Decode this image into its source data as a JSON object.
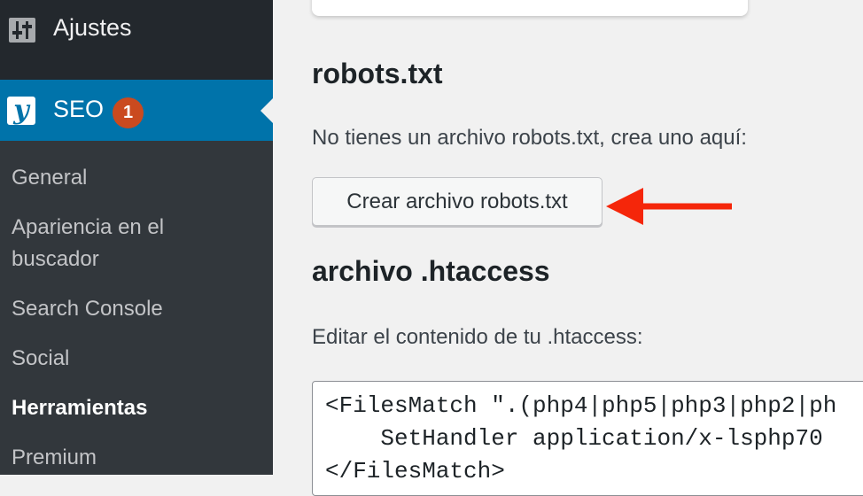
{
  "sidebar": {
    "ajustes": {
      "label": "Ajustes",
      "icon": "sliders-icon"
    },
    "seo": {
      "label": "SEO",
      "badge": "1",
      "logo_letter": "y",
      "icon": "yoast-logo-icon"
    },
    "items": [
      {
        "label": "General"
      },
      {
        "label": "Apariencia en el"
      },
      {
        "label": "buscador"
      },
      {
        "label": "Search Console"
      },
      {
        "label": "Social"
      },
      {
        "label": "Herramientas"
      },
      {
        "label": "Premium"
      }
    ]
  },
  "main": {
    "robots": {
      "heading": "robots.txt",
      "description": "No tienes un archivo robots.txt, crea uno aquí:",
      "button_label": "Crear archivo robots.txt"
    },
    "htaccess": {
      "heading": "archivo .htaccess",
      "description": "Editar el contenido de tu .htaccess:",
      "lines": [
        "<FilesMatch \".(php4|php5|php3|php2|ph",
        "    SetHandler application/x-lsphp70",
        "</FilesMatch>"
      ]
    }
  },
  "colors": {
    "sidebar_bg": "#32373c",
    "sidebar_top_bg": "#23282d",
    "active_bg": "#0073aa",
    "badge_bg": "#ca4a1f",
    "arrow": "#f5260a"
  }
}
